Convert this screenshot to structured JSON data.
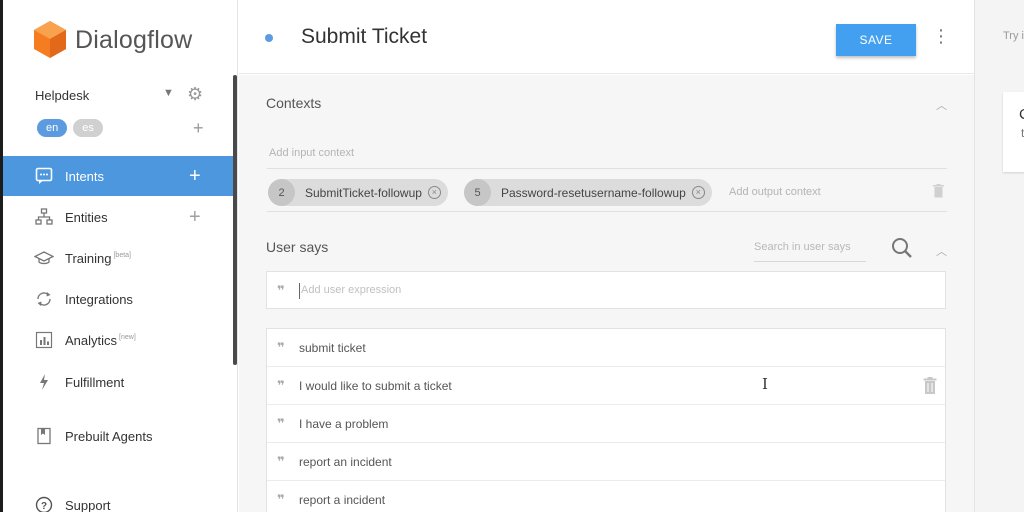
{
  "brand": {
    "name": "Dialogflow",
    "logo_color": "#f57c20"
  },
  "agent": {
    "name": "Helpdesk",
    "languages": [
      {
        "code": "en",
        "active": true
      },
      {
        "code": "es",
        "active": false
      }
    ]
  },
  "sidebar": {
    "items": [
      {
        "label": "Intents",
        "badge": "",
        "has_add": true,
        "active": true,
        "icon": "chat-bubble-icon"
      },
      {
        "label": "Entities",
        "badge": "",
        "has_add": true,
        "active": false,
        "icon": "hierarchy-icon"
      },
      {
        "label": "Training",
        "badge": "[beta]",
        "has_add": false,
        "active": false,
        "icon": "graduation-cap-icon"
      },
      {
        "label": "Integrations",
        "badge": "",
        "has_add": false,
        "active": false,
        "icon": "sync-icon"
      },
      {
        "label": "Analytics",
        "badge": "[new]",
        "has_add": false,
        "active": false,
        "icon": "bar-chart-icon"
      },
      {
        "label": "Fulfillment",
        "badge": "",
        "has_add": false,
        "active": false,
        "icon": "lightning-icon"
      },
      {
        "label": "Prebuilt Agents",
        "badge": "",
        "has_add": false,
        "active": false,
        "icon": "book-icon"
      },
      {
        "label": "Support",
        "badge": "",
        "has_add": false,
        "active": false,
        "icon": "help-icon"
      }
    ],
    "accent_color": "#4d97df"
  },
  "header": {
    "intent_title": "Submit Ticket",
    "save_label": "SAVE",
    "more_label": "⋮"
  },
  "right_panel": {
    "try_it_text": "Try i",
    "card_letter": "C",
    "card_text": "t"
  },
  "contexts": {
    "title": "Contexts",
    "input_placeholder": "Add input context",
    "output_contexts": [
      {
        "count": "2",
        "name": "SubmitTicket-followup"
      },
      {
        "count": "5",
        "name": "Password-resetusername-followup"
      }
    ],
    "output_placeholder": "Add output context"
  },
  "user_says": {
    "title": "User says",
    "search_placeholder": "Search in user says",
    "add_placeholder": "Add user expression",
    "phrases": [
      "submit ticket",
      "I would like to submit a ticket",
      "I have a problem",
      "report an incident",
      "report a incident"
    ]
  }
}
